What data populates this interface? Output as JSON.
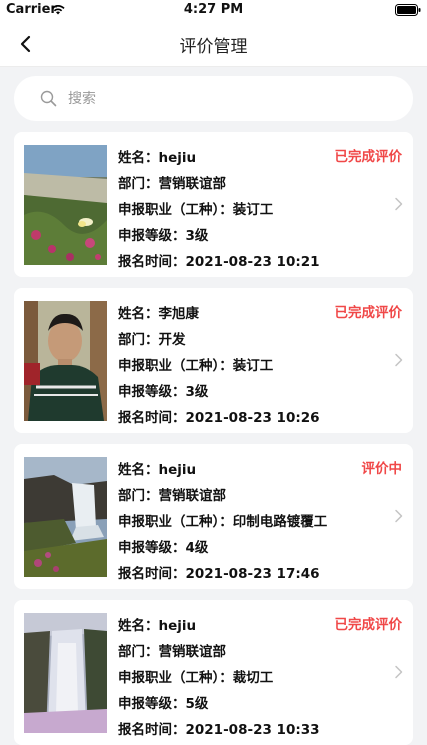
{
  "status_bar": {
    "carrier": "Carrier",
    "time": "4:27 PM"
  },
  "nav": {
    "title": "评价管理"
  },
  "search": {
    "placeholder": "搜索",
    "value": ""
  },
  "labels": {
    "name": "姓名：",
    "department": "部门：",
    "occupation": "申报职业（工种）：",
    "level": "申报等级：",
    "signup_time": "报名时间："
  },
  "records": [
    {
      "name": "hejiu",
      "department": "营销联谊部",
      "occupation": "装订工",
      "level": "3级",
      "signup_time": "2021-08-23 10:21",
      "status": "已完成评价",
      "photo": "beach-flowers"
    },
    {
      "name": "李旭康",
      "department": "开发",
      "occupation": "装订工",
      "level": "3级",
      "signup_time": "2021-08-23 10:26",
      "status": "已完成评价",
      "photo": "portrait"
    },
    {
      "name": "hejiu",
      "department": "营销联谊部",
      "occupation": "印制电路镀覆工",
      "level": "4级",
      "signup_time": "2021-08-23 17:46",
      "status": "评价中",
      "photo": "waterfall"
    },
    {
      "name": "hejiu",
      "department": "营销联谊部",
      "occupation": "裁切工",
      "level": "5级",
      "signup_time": "2021-08-23 10:33",
      "status": "已完成评价",
      "photo": "waterfall-tall"
    }
  ],
  "colors": {
    "status": "#f04848",
    "background": "#f2f3f5",
    "card": "#ffffff"
  }
}
